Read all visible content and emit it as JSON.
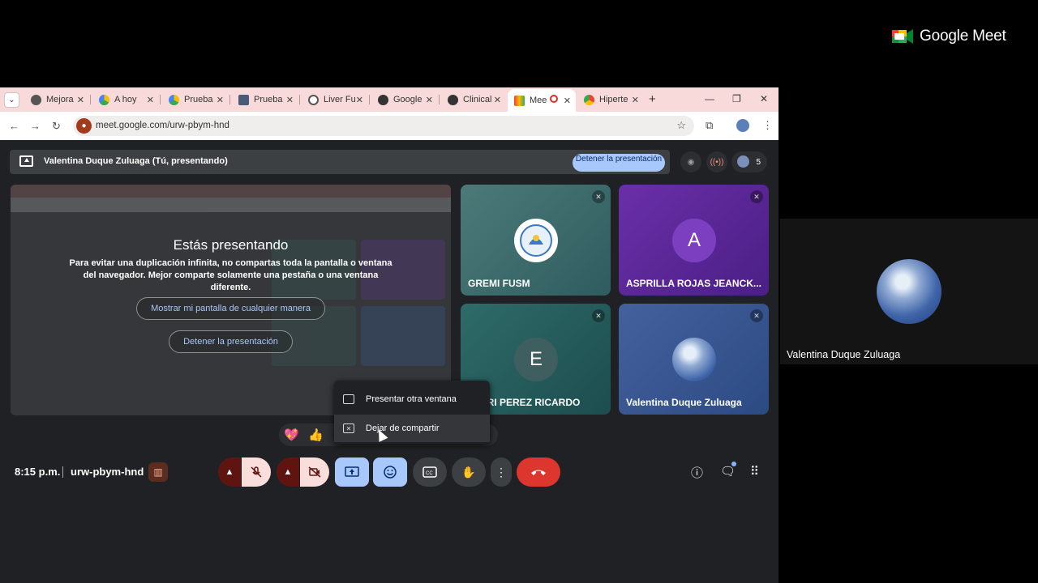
{
  "brand": {
    "name": "Google Meet"
  },
  "self_view": {
    "name": "Valentina Duque Zuluaga"
  },
  "browser": {
    "tabs": [
      {
        "label": "Mejora",
        "favicon": "openai-icon"
      },
      {
        "label": "A hoy",
        "favicon": "drive-icon"
      },
      {
        "label": "Prueba",
        "favicon": "drive-icon"
      },
      {
        "label": "Prueba",
        "favicon": "slides-icon"
      },
      {
        "label": "Liver Fu",
        "favicon": "globe-icon"
      },
      {
        "label": "Google",
        "favicon": "openai-icon"
      },
      {
        "label": "Clinical",
        "favicon": "openai-icon"
      },
      {
        "label": "Mee",
        "favicon": "meet-icon"
      },
      {
        "label": "Hiperte",
        "favicon": "chrome-icon"
      }
    ],
    "url": "meet.google.com/urw-pbym-hnd"
  },
  "meet": {
    "presenting_bar": {
      "text": "Valentina Duque Zuluaga (Tú, presentando)",
      "stop_label": "Detener la presentación",
      "participant_count": "5"
    },
    "presenting_overlay": {
      "title": "Estás presentando",
      "message": "Para evitar una duplicación infinita, no compartas toda la pantalla o ventana del navegador. Mejor comparte solamente una pestaña o una ventana diferente.",
      "show_anyway_label": "Mostrar mi pantalla de cualquier manera",
      "stop_label": "Detener la presentación"
    },
    "tiles": [
      {
        "name": "GREMI FUSM",
        "initial": ""
      },
      {
        "name": "ASPRILLA ROJAS JEANCK...",
        "initial": "A"
      },
      {
        "name": "EVERRI PEREZ RICARDO",
        "initial": "E"
      },
      {
        "name": "Valentina Duque Zuluaga",
        "initial": ""
      }
    ],
    "share_menu": {
      "present_other": "Presentar otra ventana",
      "stop_sharing": "Dejar de compartir"
    },
    "reactions": [
      "💖",
      "👍"
    ],
    "time": "8:15 p.m.",
    "meeting_code": "urw-pbym-hnd"
  },
  "colors": {
    "end_call": "#dc362e",
    "accent_blue": "#a8c7fa",
    "mic_off_bg": "#f9dedc"
  }
}
